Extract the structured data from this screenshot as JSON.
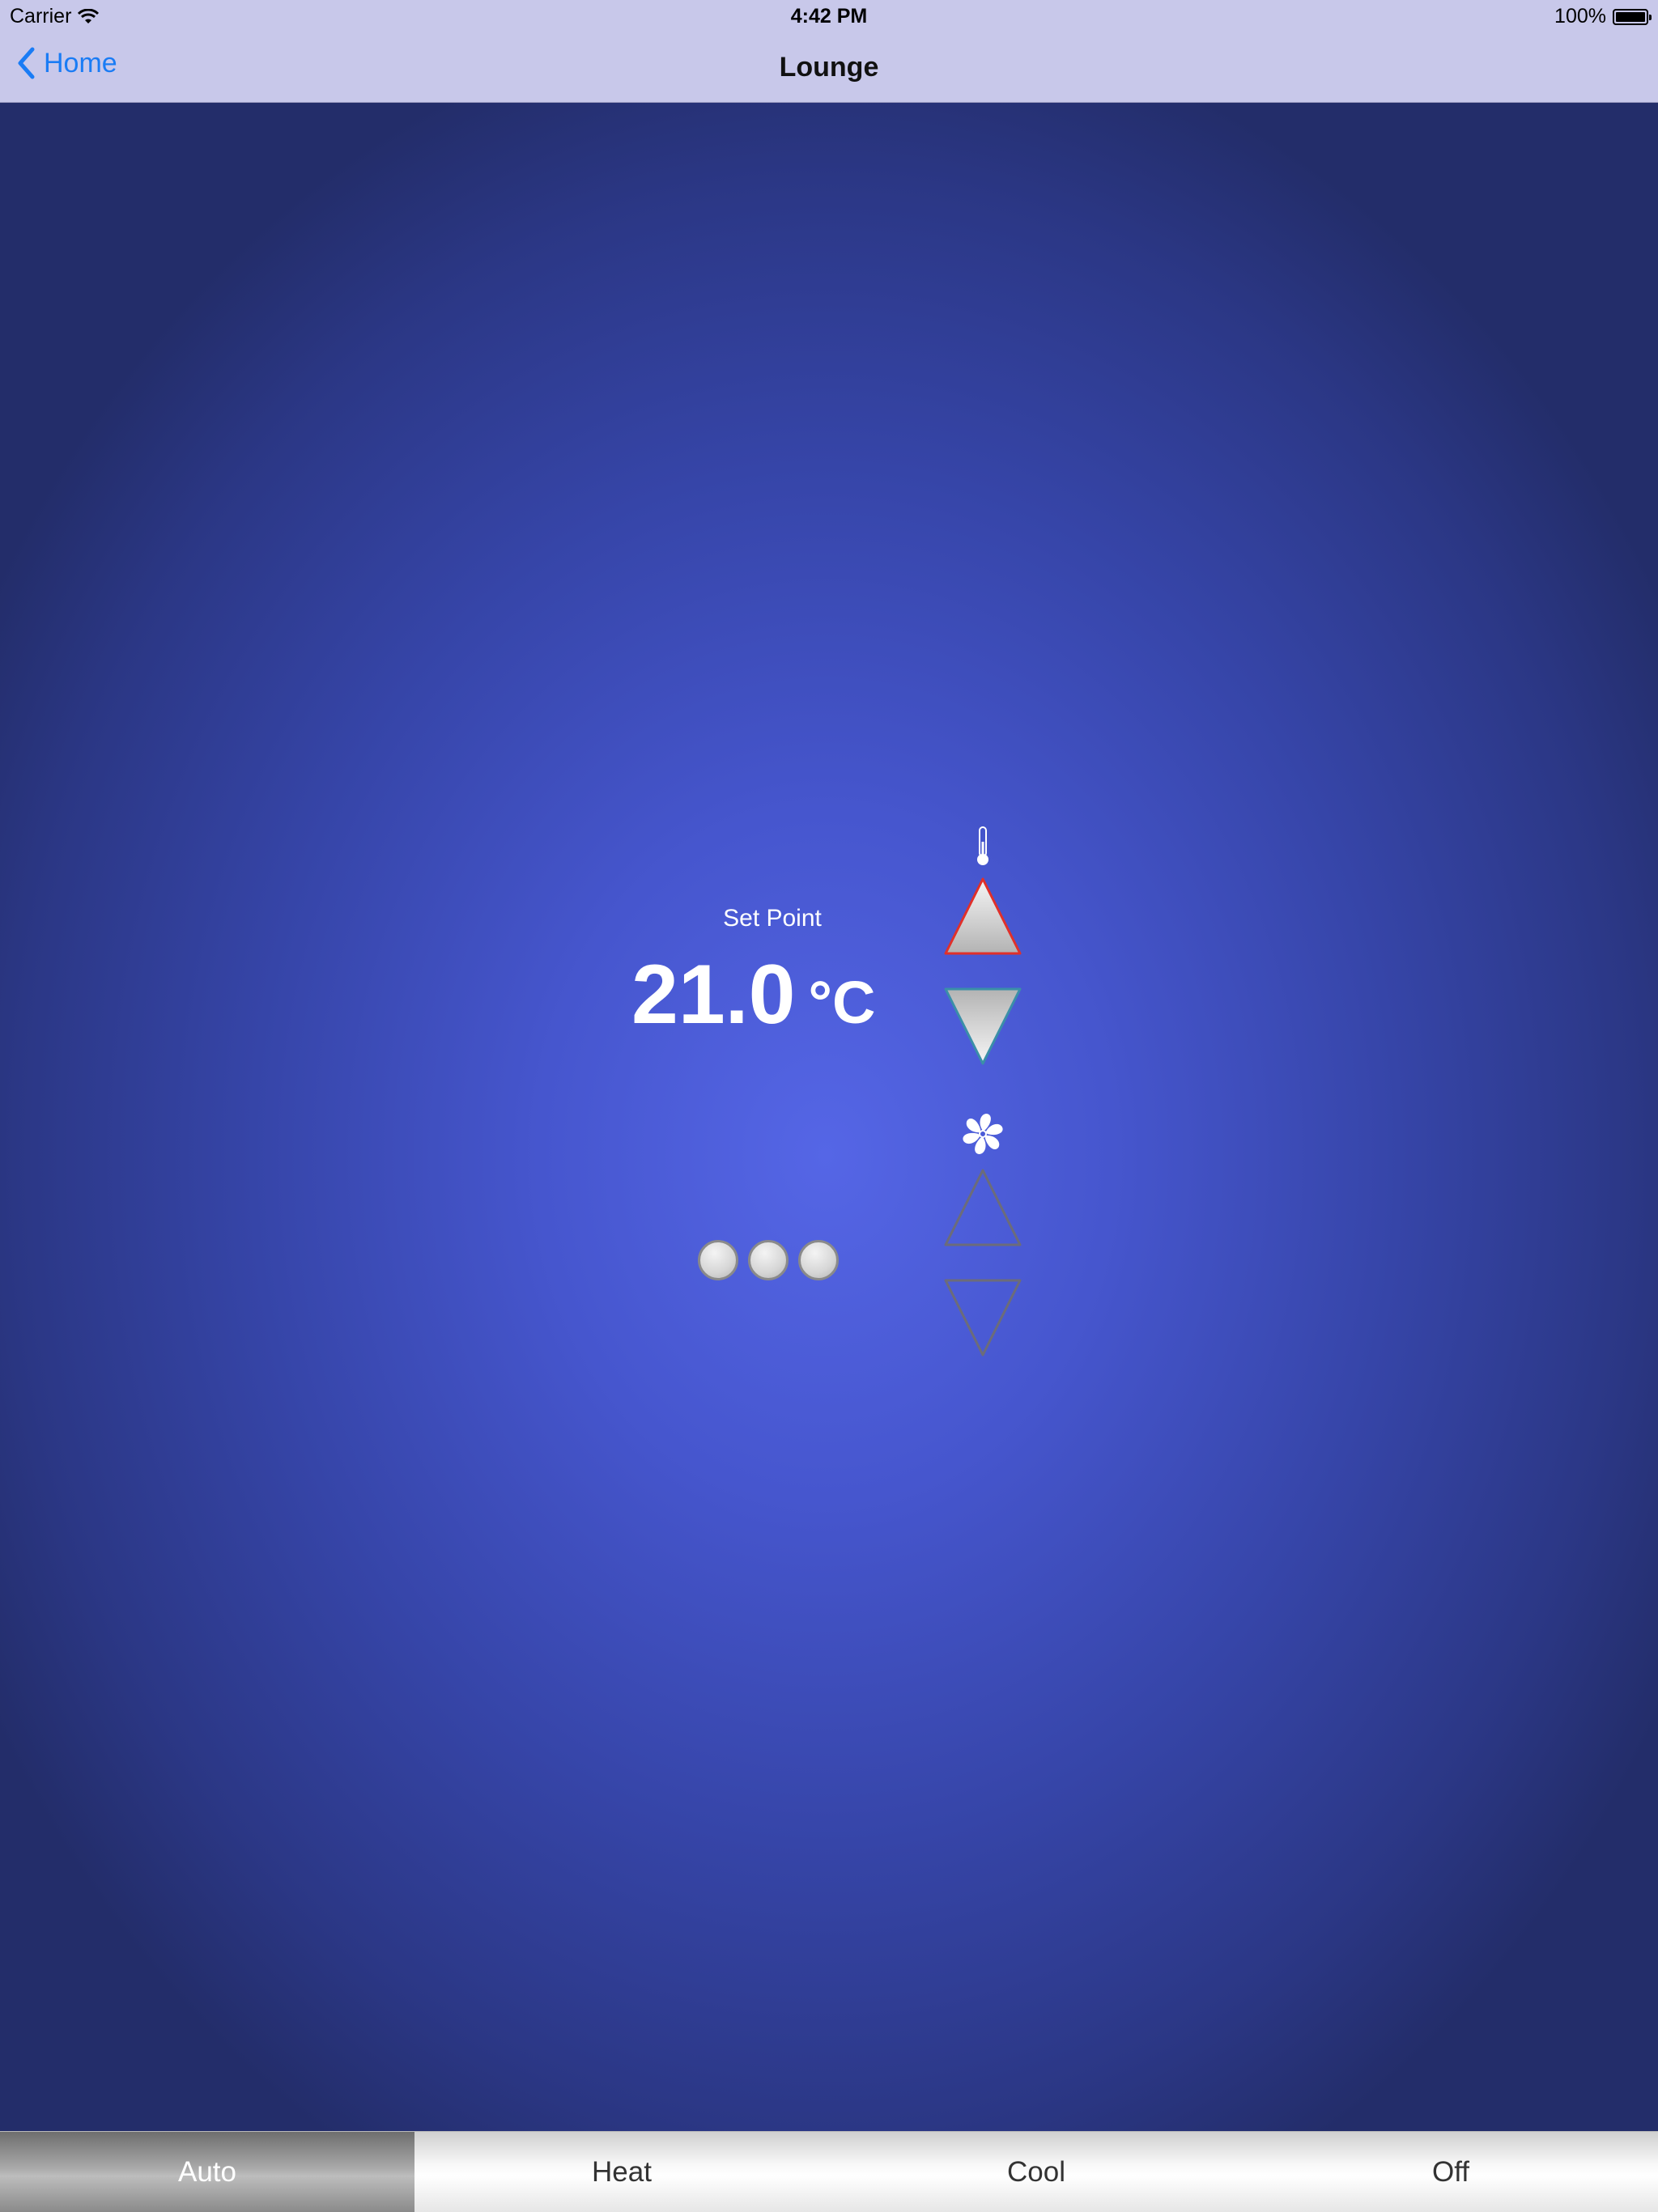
{
  "status_bar": {
    "carrier": "Carrier",
    "time": "4:42 PM",
    "battery": "100%"
  },
  "nav": {
    "back_label": "Home",
    "title": "Lounge"
  },
  "setpoint": {
    "label": "Set Point",
    "value": "21.0",
    "unit": "°C"
  },
  "fan": {
    "speed_levels": 3
  },
  "tabs": [
    {
      "label": "Auto",
      "selected": true
    },
    {
      "label": "Heat",
      "selected": false
    },
    {
      "label": "Cool",
      "selected": false
    },
    {
      "label": "Off",
      "selected": false
    }
  ],
  "colors": {
    "accent": "#1a7cf5",
    "bar_background": "#c8c8ea",
    "background_center": "#5566e6",
    "background_edge": "#232d6a",
    "temp_up_outline": "#e0302a",
    "temp_down_outline": "#3a8fa8"
  },
  "icons": {
    "back": "chevron-left-icon",
    "wifi": "wifi-icon",
    "battery": "battery-icon",
    "temperature": "thermometer-icon",
    "fan": "fan-icon"
  }
}
